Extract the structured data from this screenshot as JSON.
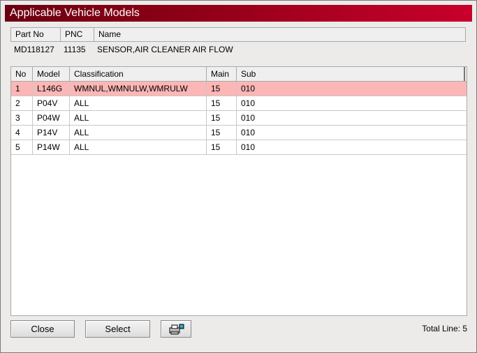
{
  "window": {
    "title": "Applicable Vehicle Models"
  },
  "part": {
    "headers": {
      "part_no": "Part No",
      "pnc": "PNC",
      "name": "Name"
    },
    "values": {
      "part_no": "MD118127",
      "pnc": "11135",
      "name": "SENSOR,AIR CLEANER AIR FLOW"
    }
  },
  "models": {
    "headers": {
      "no": "No",
      "model": "Model",
      "classification": "Classification",
      "main": "Main",
      "sub": "Sub"
    },
    "rows": [
      {
        "no": "1",
        "model": "L146G",
        "classification": "WMNUL,WMNULW,WMRULW",
        "main": "15",
        "sub": "010",
        "selected": true
      },
      {
        "no": "2",
        "model": "P04V",
        "classification": "ALL",
        "main": "15",
        "sub": "010"
      },
      {
        "no": "3",
        "model": "P04W",
        "classification": "ALL",
        "main": "15",
        "sub": "010"
      },
      {
        "no": "4",
        "model": "P14V",
        "classification": "ALL",
        "main": "15",
        "sub": "010"
      },
      {
        "no": "5",
        "model": "P14W",
        "classification": "ALL",
        "main": "15",
        "sub": "010"
      }
    ]
  },
  "footer": {
    "close_label": "Close",
    "select_label": "Select",
    "print_icon": "printer-icon",
    "total_line": "Total Line: 5"
  },
  "colors": {
    "title_gradient_start": "#6b0010",
    "title_gradient_end": "#c8002c",
    "selected_row": "#fbb6b6"
  }
}
